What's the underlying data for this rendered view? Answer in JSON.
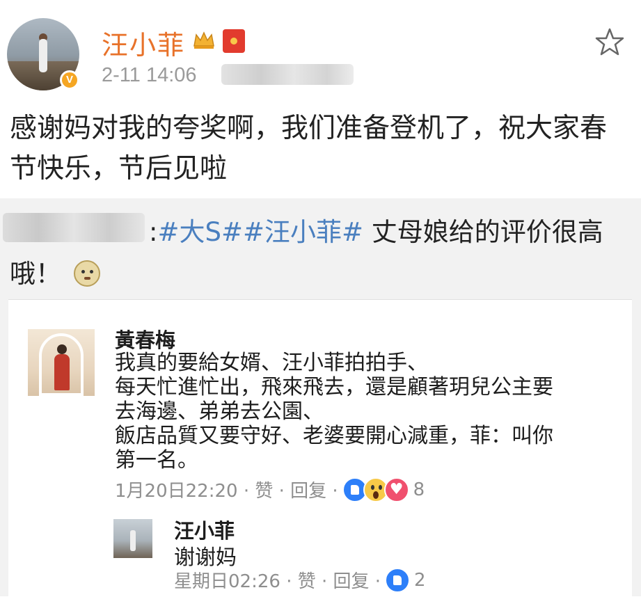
{
  "post": {
    "username": "汪小菲",
    "timestamp": "2-11 14:06",
    "text": "感谢妈对我的夸奖啊，我们准备登机了，祝大家春节快乐，节后见啦"
  },
  "repost": {
    "separator": ":",
    "topic1": "#大S#",
    "topic2": "#汪小菲#",
    "text": " 丈母娘给的评价很高哦！"
  },
  "fb_comment": {
    "name": "黃春梅",
    "lines": [
      "我真的要給女婿、汪小菲拍拍手、",
      "每天忙進忙出，飛來飛去，還是顧著玥兒公主要",
      "去海邊、弟弟去公園、",
      "飯店品質又要守好、老婆要開心減重，菲：叫你",
      "第一名。"
    ],
    "meta_time": "1月20日22:20 · 赞 · 回复 ·",
    "reaction_count": "8",
    "reply": {
      "name": "汪小菲",
      "text": "谢谢妈",
      "meta_time": "星期日02:26 · 赞 · 回复 ·",
      "reaction_count": "2"
    }
  },
  "colors": {
    "username": "#e8722a",
    "topic": "#4a7fbf",
    "muted": "#9a9a9a",
    "repost_bg": "#f2f2f2"
  },
  "icons": [
    "v-badge",
    "crown-icon",
    "red-packet-icon",
    "star-icon",
    "doge-emoji-icon",
    "like-icon",
    "wow-icon",
    "love-icon"
  ]
}
